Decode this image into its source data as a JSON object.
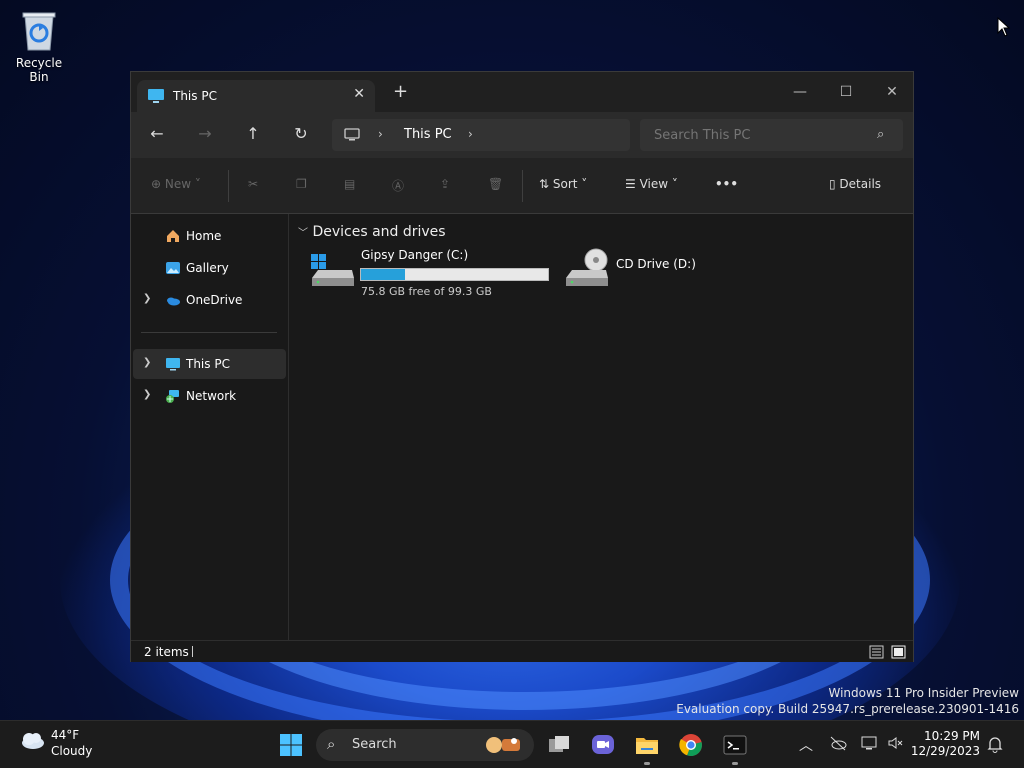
{
  "desktop": {
    "recycle_bin_label": "Recycle Bin",
    "watermark_line1": "Windows 11 Pro Insider Preview",
    "watermark_line2": "Evaluation copy. Build 25947.rs_prerelease.230901-1416"
  },
  "window": {
    "tab_title": "This PC",
    "close_tab_glyph": "✕",
    "new_tab_glyph": "+",
    "controls": {
      "minimize": "—",
      "maximize": "☐",
      "close": "✕"
    },
    "address": {
      "crumb": "This PC"
    },
    "search": {
      "placeholder": "Search This PC"
    },
    "commands": {
      "new_label": "New",
      "sort_label": "Sort",
      "view_label": "View",
      "more_label": "•••",
      "details_label": "Details"
    },
    "sidebar": {
      "items": [
        {
          "label": "Home",
          "icon": "home-icon"
        },
        {
          "label": "Gallery",
          "icon": "gallery-icon"
        },
        {
          "label": "OneDrive",
          "icon": "onedrive-icon"
        },
        {
          "label": "This PC",
          "icon": "this-pc-icon"
        },
        {
          "label": "Network",
          "icon": "network-icon"
        }
      ]
    },
    "content": {
      "group_title": "Devices and drives",
      "drives": [
        {
          "name": "Gipsy Danger (C:)",
          "free_text": "75.8 GB free of 99.3 GB",
          "used_fraction": 0.237,
          "icon": "windows-drive-icon"
        },
        {
          "name": "CD Drive (D:)",
          "icon": "cd-drive-icon"
        }
      ]
    },
    "status": {
      "item_count": "2 items"
    }
  },
  "taskbar": {
    "weather": {
      "temp": "44°F",
      "desc": "Cloudy",
      "icon": "cloud-icon"
    },
    "search_label": "Search",
    "clock": {
      "time": "10:29 PM",
      "date": "12/29/2023"
    }
  },
  "colors": {
    "accent": "#26a0da",
    "window_bg": "#191919",
    "taskbar_bg": "#1c1c1c"
  }
}
